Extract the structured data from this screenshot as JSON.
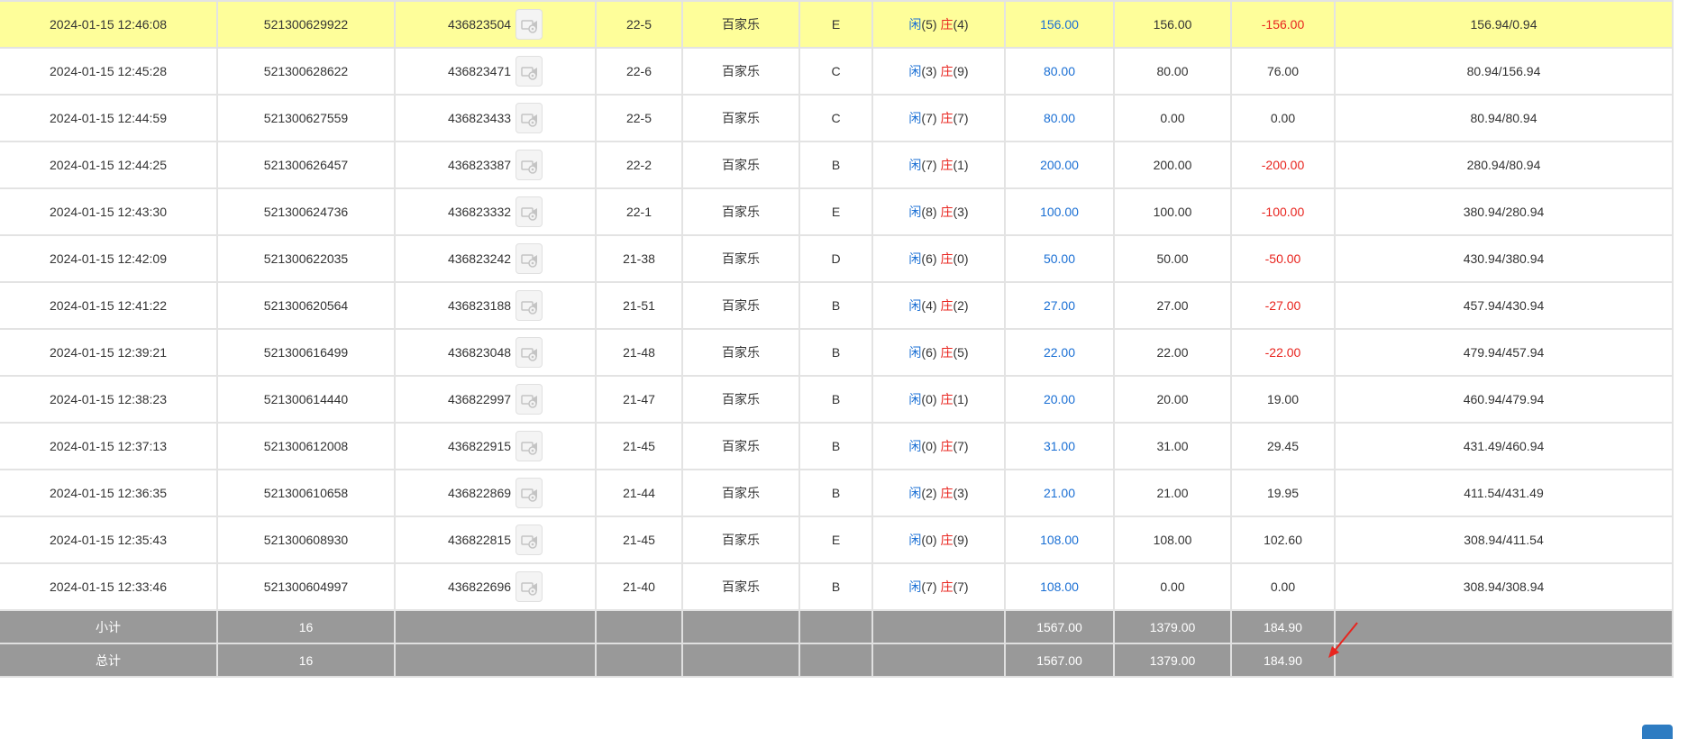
{
  "rows": [
    {
      "time": "2024-01-15 12:46:08",
      "order": "521300629922",
      "game_no": "436823504",
      "table": "22-5",
      "game": "百家乐",
      "bet": "E",
      "x_label": "闲",
      "x_val": "(5)",
      "z_label": "庄",
      "z_val": "(4)",
      "amount": "156.00",
      "valid": "156.00",
      "winloss": "-156.00",
      "balance": "156.94/0.94",
      "winloss_neg": true,
      "highlight": true
    },
    {
      "time": "2024-01-15 12:45:28",
      "order": "521300628622",
      "game_no": "436823471",
      "table": "22-6",
      "game": "百家乐",
      "bet": "C",
      "x_label": "闲",
      "x_val": "(3)",
      "z_label": "庄",
      "z_val": "(9)",
      "amount": "80.00",
      "valid": "80.00",
      "winloss": "76.00",
      "balance": "80.94/156.94",
      "winloss_neg": false,
      "highlight": false
    },
    {
      "time": "2024-01-15 12:44:59",
      "order": "521300627559",
      "game_no": "436823433",
      "table": "22-5",
      "game": "百家乐",
      "bet": "C",
      "x_label": "闲",
      "x_val": "(7)",
      "z_label": "庄",
      "z_val": "(7)",
      "amount": "80.00",
      "valid": "0.00",
      "winloss": "0.00",
      "balance": "80.94/80.94",
      "winloss_neg": false,
      "highlight": false
    },
    {
      "time": "2024-01-15 12:44:25",
      "order": "521300626457",
      "game_no": "436823387",
      "table": "22-2",
      "game": "百家乐",
      "bet": "B",
      "x_label": "闲",
      "x_val": "(7)",
      "z_label": "庄",
      "z_val": "(1)",
      "amount": "200.00",
      "valid": "200.00",
      "winloss": "-200.00",
      "balance": "280.94/80.94",
      "winloss_neg": true,
      "highlight": false
    },
    {
      "time": "2024-01-15 12:43:30",
      "order": "521300624736",
      "game_no": "436823332",
      "table": "22-1",
      "game": "百家乐",
      "bet": "E",
      "x_label": "闲",
      "x_val": "(8)",
      "z_label": "庄",
      "z_val": "(3)",
      "amount": "100.00",
      "valid": "100.00",
      "winloss": "-100.00",
      "balance": "380.94/280.94",
      "winloss_neg": true,
      "highlight": false
    },
    {
      "time": "2024-01-15 12:42:09",
      "order": "521300622035",
      "game_no": "436823242",
      "table": "21-38",
      "game": "百家乐",
      "bet": "D",
      "x_label": "闲",
      "x_val": "(6)",
      "z_label": "庄",
      "z_val": "(0)",
      "amount": "50.00",
      "valid": "50.00",
      "winloss": "-50.00",
      "balance": "430.94/380.94",
      "winloss_neg": true,
      "highlight": false
    },
    {
      "time": "2024-01-15 12:41:22",
      "order": "521300620564",
      "game_no": "436823188",
      "table": "21-51",
      "game": "百家乐",
      "bet": "B",
      "x_label": "闲",
      "x_val": "(4)",
      "z_label": "庄",
      "z_val": "(2)",
      "amount": "27.00",
      "valid": "27.00",
      "winloss": "-27.00",
      "balance": "457.94/430.94",
      "winloss_neg": true,
      "highlight": false
    },
    {
      "time": "2024-01-15 12:39:21",
      "order": "521300616499",
      "game_no": "436823048",
      "table": "21-48",
      "game": "百家乐",
      "bet": "B",
      "x_label": "闲",
      "x_val": "(6)",
      "z_label": "庄",
      "z_val": "(5)",
      "amount": "22.00",
      "valid": "22.00",
      "winloss": "-22.00",
      "balance": "479.94/457.94",
      "winloss_neg": true,
      "highlight": false
    },
    {
      "time": "2024-01-15 12:38:23",
      "order": "521300614440",
      "game_no": "436822997",
      "table": "21-47",
      "game": "百家乐",
      "bet": "B",
      "x_label": "闲",
      "x_val": "(0)",
      "z_label": "庄",
      "z_val": "(1)",
      "amount": "20.00",
      "valid": "20.00",
      "winloss": "19.00",
      "balance": "460.94/479.94",
      "winloss_neg": false,
      "highlight": false
    },
    {
      "time": "2024-01-15 12:37:13",
      "order": "521300612008",
      "game_no": "436822915",
      "table": "21-45",
      "game": "百家乐",
      "bet": "B",
      "x_label": "闲",
      "x_val": "(0)",
      "z_label": "庄",
      "z_val": "(7)",
      "amount": "31.00",
      "valid": "31.00",
      "winloss": "29.45",
      "balance": "431.49/460.94",
      "winloss_neg": false,
      "highlight": false
    },
    {
      "time": "2024-01-15 12:36:35",
      "order": "521300610658",
      "game_no": "436822869",
      "table": "21-44",
      "game": "百家乐",
      "bet": "B",
      "x_label": "闲",
      "x_val": "(2)",
      "z_label": "庄",
      "z_val": "(3)",
      "amount": "21.00",
      "valid": "21.00",
      "winloss": "19.95",
      "balance": "411.54/431.49",
      "winloss_neg": false,
      "highlight": false
    },
    {
      "time": "2024-01-15 12:35:43",
      "order": "521300608930",
      "game_no": "436822815",
      "table": "21-45",
      "game": "百家乐",
      "bet": "E",
      "x_label": "闲",
      "x_val": "(0)",
      "z_label": "庄",
      "z_val": "(9)",
      "amount": "108.00",
      "valid": "108.00",
      "winloss": "102.60",
      "balance": "308.94/411.54",
      "winloss_neg": false,
      "highlight": false
    },
    {
      "time": "2024-01-15 12:33:46",
      "order": "521300604997",
      "game_no": "436822696",
      "table": "21-40",
      "game": "百家乐",
      "bet": "B",
      "x_label": "闲",
      "x_val": "(7)",
      "z_label": "庄",
      "z_val": "(7)",
      "amount": "108.00",
      "valid": "0.00",
      "winloss": "0.00",
      "balance": "308.94/308.94",
      "winloss_neg": false,
      "highlight": false
    }
  ],
  "subtotal": {
    "label": "小计",
    "count": "16",
    "amount": "1567.00",
    "valid": "1379.00",
    "winloss": "184.90"
  },
  "total": {
    "label": "总计",
    "count": "16",
    "amount": "1567.00",
    "valid": "1379.00",
    "winloss": "184.90"
  },
  "colors": {
    "highlight": "#fefe9a",
    "blue": "#1a6fd4",
    "red": "#e8241e",
    "summary_bg": "#999999",
    "arrow": "#e8241e",
    "button": "#2e7cc2"
  },
  "icons": {
    "replay": "video-replay-icon",
    "cursor": "red-arrow-cursor-icon"
  }
}
